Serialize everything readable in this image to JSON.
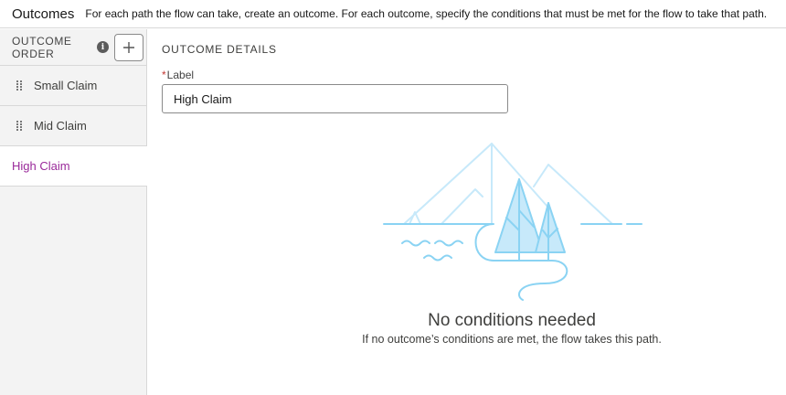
{
  "header": {
    "title": "Outcomes",
    "description": "For each path the flow can take, create an outcome. For each outcome, specify the conditions that must be met for the flow to take that path."
  },
  "sidebar": {
    "heading": "OUTCOME ORDER",
    "add_icon": "plus-icon",
    "info_icon": "info-icon",
    "items": [
      {
        "label": "Small Claim",
        "active": false
      },
      {
        "label": "Mid Claim",
        "active": false
      },
      {
        "label": "High Claim",
        "active": true
      }
    ]
  },
  "details": {
    "section_title": "OUTCOME DETAILS",
    "label_field": {
      "label": "Label",
      "required": true,
      "value": "High Claim"
    }
  },
  "empty_state": {
    "illustration": "mountains-trees-illustration",
    "title": "No conditions needed",
    "subtitle": "If no outcome’s conditions are met, the flow takes this path."
  },
  "colors": {
    "active_item": "#9a2a9a",
    "illustration_stroke": "#8ad3f3",
    "required_star": "#c23934"
  }
}
